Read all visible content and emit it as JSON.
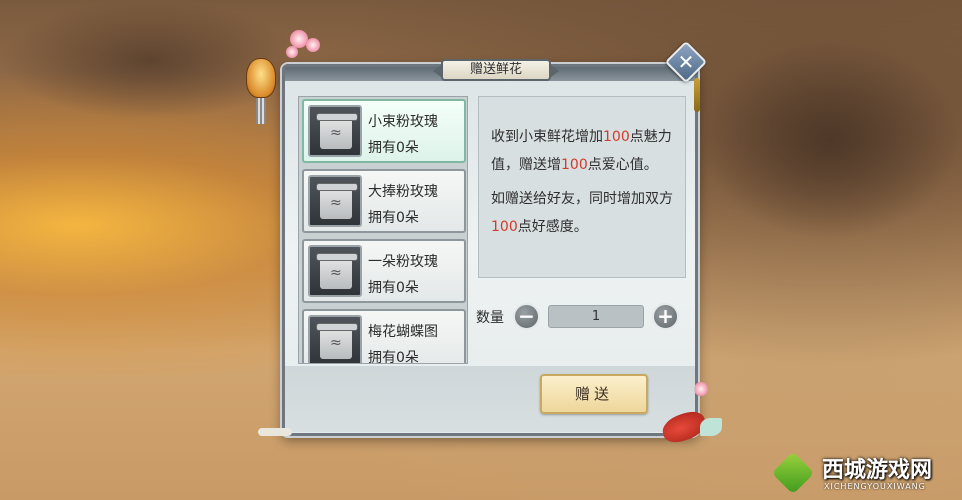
{
  "dialog": {
    "title": "赠送鲜花",
    "close_icon": "close-icon"
  },
  "items": [
    {
      "name": "小束粉玫瑰",
      "count": "拥有0朵",
      "selected": true
    },
    {
      "name": "大捧粉玫瑰",
      "count": "拥有0朵",
      "selected": false
    },
    {
      "name": "一朵粉玫瑰",
      "count": "拥有0朵",
      "selected": false
    },
    {
      "name": "梅花蝴蝶图",
      "count": "拥有0朵",
      "selected": false
    }
  ],
  "description": {
    "p1_a": "收到小束鲜花增加",
    "p1_num1": "100",
    "p1_b": "点魅力值，赠送增",
    "p1_num2": "100",
    "p1_c": "点爱心值。",
    "p2_a": "如赠送给好友，同时增加双方",
    "p2_num": "100",
    "p2_b": "点好感度。"
  },
  "quantity": {
    "label": "数量",
    "value": "1",
    "minus": "−",
    "plus": "+"
  },
  "send_button": "赠送",
  "watermark": {
    "title": "西城游戏网",
    "subtitle": "XICHENGYOUXIWANG"
  },
  "colors": {
    "highlight": "#d23a2a",
    "selected_item": "#ddf3ea",
    "send_button": "#eed69a"
  }
}
